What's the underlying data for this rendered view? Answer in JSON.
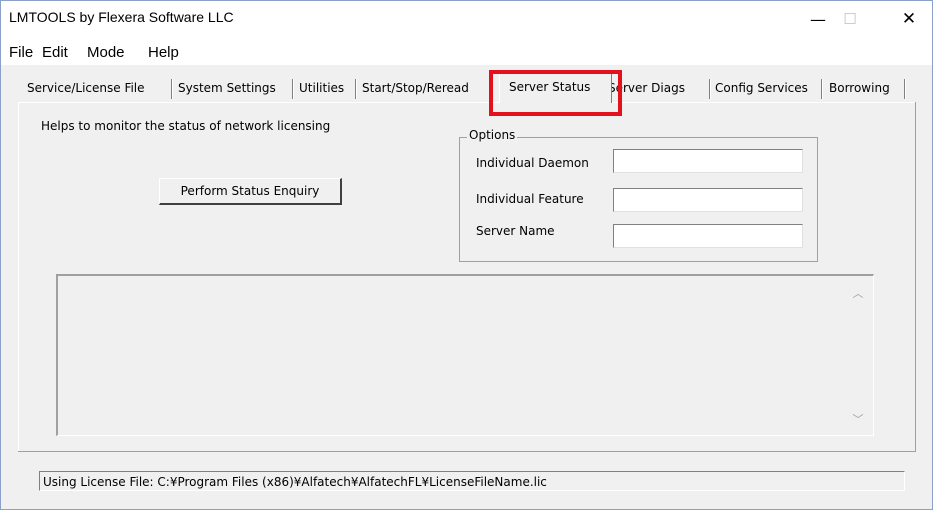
{
  "window": {
    "title": "LMTOOLS by Flexera Software LLC",
    "controls": {
      "minimize": "—",
      "maximize": "☐",
      "close": "✕"
    }
  },
  "menu": [
    "File",
    "Edit",
    "Mode",
    "Help"
  ],
  "tabs": [
    "Service/License File",
    "System Settings",
    "Utilities",
    "Start/Stop/Reread",
    "Server Status",
    "Server Diags",
    "Config Services",
    "Borrowing"
  ],
  "active_tab": "Server Status",
  "panel": {
    "help_text": "Helps to monitor the status of network licensing",
    "perform_button": "Perform Status Enquiry",
    "options": {
      "title": "Options",
      "fields": [
        {
          "label": "Individual Daemon",
          "value": ""
        },
        {
          "label": "Individual Feature",
          "value": ""
        },
        {
          "label": "Server Name",
          "value": ""
        }
      ]
    },
    "output_text": ""
  },
  "statusbar": "Using License File:  C:¥Program Files (x86)¥Alfatech¥AlfatechFL¥LicenseFileName.lic",
  "colors": {
    "highlight": "#e3111e",
    "window_bg": "#f0f0f0"
  }
}
